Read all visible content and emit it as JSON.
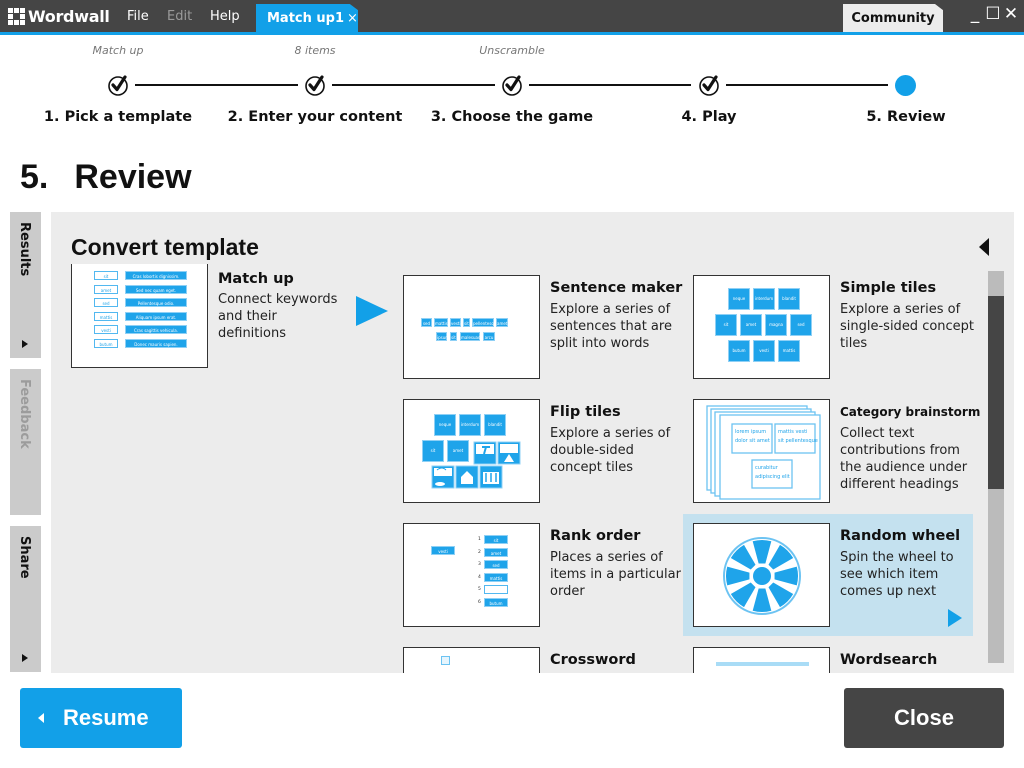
{
  "app": {
    "name": "Wordwall",
    "menu": [
      {
        "label": "File",
        "enabled": true
      },
      {
        "label": "Edit",
        "enabled": false
      },
      {
        "label": "Help",
        "enabled": true
      }
    ],
    "active_tab": {
      "label": "Match up1",
      "close": "×"
    },
    "community_tab": "Community",
    "window_controls": {
      "minimize": "_",
      "maximize": "☐",
      "close": "✕"
    },
    "accent_color": "#12a0e8",
    "bar_color": "#454545"
  },
  "stepper": {
    "steps": [
      {
        "label": "1. Pick a template",
        "sub": "Match up",
        "state": "done"
      },
      {
        "label": "2. Enter your content",
        "sub": "8 items",
        "state": "done"
      },
      {
        "label": "3. Choose the game",
        "sub": "Unscramble",
        "state": "done"
      },
      {
        "label": "4. Play",
        "sub": "",
        "state": "done"
      },
      {
        "label": "5. Review",
        "sub": "",
        "state": "current"
      }
    ]
  },
  "page": {
    "number": "5.",
    "title": "Review"
  },
  "side_tabs": [
    {
      "label": "Results",
      "enabled": true,
      "has_arrow": true
    },
    {
      "label": "Feedback",
      "enabled": false,
      "has_arrow": false
    },
    {
      "label": "Share",
      "enabled": true,
      "has_arrow": true
    }
  ],
  "panel": {
    "title": "Convert template",
    "current": {
      "title": "Match up",
      "desc": "Connect keywords and their definitions",
      "thumb": {
        "keywords": [
          "sit",
          "amet",
          "sed",
          "mattis",
          "vesti",
          "butum"
        ],
        "definitions": [
          "Cras lobortis dignissim.",
          "Sed nec quam eget.",
          "Pellentesque odio.",
          "Aliquam ipsum erat.",
          "Cras sagittis vehicula.",
          "Donec mauris sapien."
        ]
      }
    },
    "templates": [
      {
        "title": "Sentence maker",
        "desc": "Explore a series of sentences that are split into words",
        "words_row1": [
          "sed",
          "mattis",
          "vesti",
          "sit",
          "pellentesque",
          "amet"
        ],
        "words_row2": [
          "ipsum",
          "sit",
          "malesuada",
          "arcu"
        ]
      },
      {
        "title": "Simple tiles",
        "desc": "Explore a series of single-sided concept tiles",
        "tiles": [
          [
            "neque",
            "interdum",
            "blandit"
          ],
          [
            "sit",
            "amet",
            "magna",
            "sed"
          ],
          [
            "butum",
            "vesti",
            "mattis"
          ]
        ]
      },
      {
        "title": "Flip tiles",
        "desc": "Explore a series of double-sided concept tiles",
        "tiles": [
          [
            "neque",
            "interdum",
            "blandit"
          ],
          [
            "sit",
            "amet"
          ]
        ]
      },
      {
        "title": "Category brainstorm",
        "desc": "Collect text contributions from the audience under different headings",
        "notes": [
          "lorem ipsum dolor sit amet",
          "mattis vesti sit pellentesque",
          "curabitur adipiscing elit"
        ]
      },
      {
        "title": "Rank order",
        "desc": "Places a series of items in a particular order",
        "loose_item": "vesti",
        "ranks": [
          {
            "n": "1",
            "item": "sit"
          },
          {
            "n": "2",
            "item": "amet"
          },
          {
            "n": "3",
            "item": "sed"
          },
          {
            "n": "4",
            "item": "mattis"
          },
          {
            "n": "5",
            "item": ""
          },
          {
            "n": "6",
            "item": "butum"
          }
        ]
      },
      {
        "title": "Random wheel",
        "desc": "Spin the wheel to see which item comes up next",
        "selected": true
      },
      {
        "title": "Crossword",
        "desc": ""
      },
      {
        "title": "Wordsearch",
        "desc": ""
      }
    ],
    "scroll_position": 0.1
  },
  "buttons": {
    "resume": "Resume",
    "close": "Close"
  }
}
